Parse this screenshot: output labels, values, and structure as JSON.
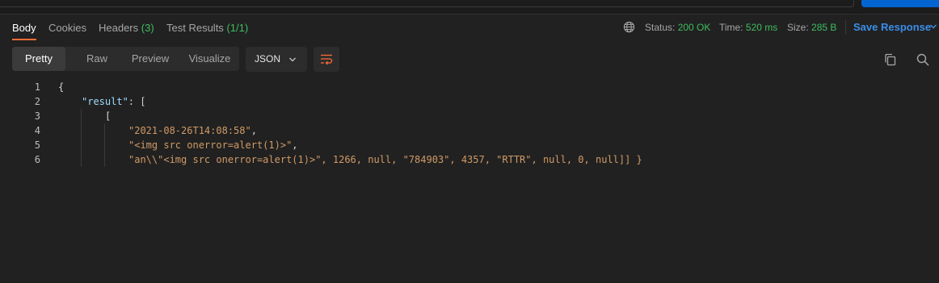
{
  "tabs": [
    {
      "label": "Body",
      "count": ""
    },
    {
      "label": "Cookies",
      "count": ""
    },
    {
      "label": "Headers",
      "count": "(3)"
    },
    {
      "label": "Test Results",
      "count": "(1/1)"
    }
  ],
  "status": {
    "label": "Status:",
    "value": "200 OK"
  },
  "time": {
    "label": "Time:",
    "value": "520 ms"
  },
  "size": {
    "label": "Size:",
    "value": "285 B"
  },
  "save_response": "Save Response",
  "view_modes": [
    "Pretty",
    "Raw",
    "Preview",
    "Visualize"
  ],
  "format": "JSON",
  "icons": {
    "globe": "globe-icon",
    "wrap": "wrap-lines-icon",
    "copy": "copy-icon",
    "search": "search-icon",
    "chevron": "chevron-down-icon"
  },
  "colors": {
    "accent": "#ff6c37",
    "success": "#3fbd5f",
    "link": "#3b8eea",
    "key": "#9cdcfe",
    "string": "#d19a66"
  },
  "code_lines": [
    {
      "num": "1",
      "text": "{"
    },
    {
      "num": "2",
      "key": "\"result\"",
      "rest": ": ["
    },
    {
      "num": "3",
      "text": "["
    },
    {
      "num": "4",
      "str": "\"2021-08-26T14:08:58\"",
      "rest": ","
    },
    {
      "num": "5",
      "str": "\"<img src onerror=alert(1)>\"",
      "rest": ","
    },
    {
      "num": "6",
      "str": "\"an\\\\\"<img src onerror=alert(1)>\"",
      "rest": ", 1266, null, \"784903\", 4357, \"RTTR\", null, 0, null]] }"
    }
  ]
}
